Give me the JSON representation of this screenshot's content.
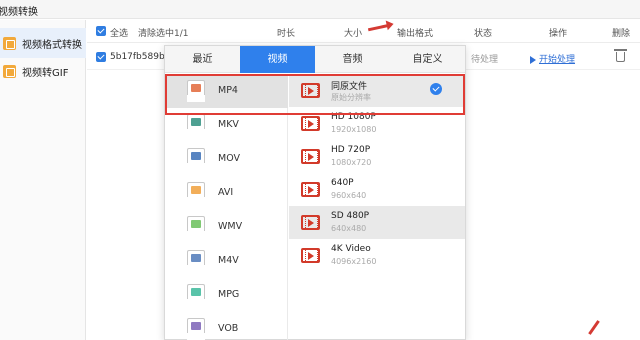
{
  "window": {
    "title": "视频转换"
  },
  "sidebar": {
    "items": [
      {
        "label": "视频格式转换",
        "icon": "video-convert-icon",
        "active": true
      },
      {
        "label": "视频转GIF",
        "icon": "gif-icon",
        "active": false
      }
    ]
  },
  "header": {
    "select_all": "全选",
    "clear_selected": "清除选中1/1",
    "duration": "时长",
    "size": "大小",
    "output_format": "输出格式",
    "status": "状态",
    "operation": "操作",
    "delete": "删除"
  },
  "file_row": {
    "name": "5b17fb589b2eb3",
    "status": "待处理",
    "action": "开始处理"
  },
  "popup": {
    "tabs": [
      {
        "label": "最近",
        "active": false
      },
      {
        "label": "视频",
        "active": true
      },
      {
        "label": "音频",
        "active": false
      },
      {
        "label": "自定义",
        "active": false
      }
    ],
    "formats": [
      {
        "label": "MP4",
        "tag": "MP4",
        "color": "#e2673a",
        "selected": true
      },
      {
        "label": "MKV",
        "tag": "MKV",
        "color": "#2f8f7f",
        "selected": false
      },
      {
        "label": "MOV",
        "tag": "MOV",
        "color": "#3b6fb6",
        "selected": false
      },
      {
        "label": "AVI",
        "tag": "AVI",
        "color": "#f0a03c",
        "selected": false
      },
      {
        "label": "WMV",
        "tag": "WMV",
        "color": "#6abf5a",
        "selected": false
      },
      {
        "label": "M4V",
        "tag": "M4V",
        "color": "#4f79b8",
        "selected": false
      },
      {
        "label": "MPG",
        "tag": "MPG",
        "color": "#3cb89a",
        "selected": false
      },
      {
        "label": "VOB",
        "tag": "VOB",
        "color": "#7b62b6",
        "selected": false
      }
    ],
    "resolutions": [
      {
        "name": "同原文件",
        "sub": "原始分辨率",
        "selected": true
      },
      {
        "name": "HD 1080P",
        "sub": "1920x1080",
        "selected": false
      },
      {
        "name": "HD 720P",
        "sub": "1080x720",
        "selected": false
      },
      {
        "name": "640P",
        "sub": "960x640",
        "selected": false
      },
      {
        "name": "SD 480P",
        "sub": "640x480",
        "selected": false
      },
      {
        "name": "4K Video",
        "sub": "4096x2160",
        "selected": false
      }
    ]
  },
  "colors": {
    "accent": "#2f80ec",
    "annotation": "#e03c35"
  }
}
